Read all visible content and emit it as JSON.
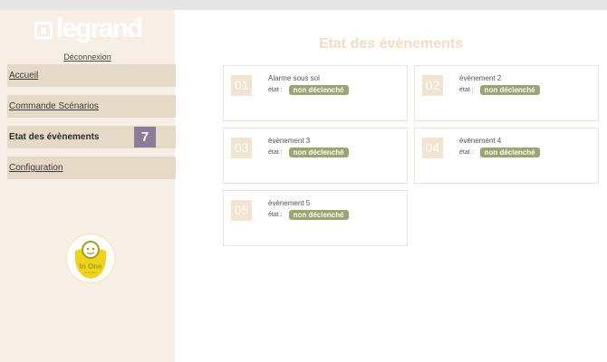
{
  "sidebar": {
    "brand": "legrand",
    "brand_mark": "®",
    "logout_label": "Déconnexion",
    "items": [
      {
        "label": "Accueil"
      },
      {
        "label": "Commande Scénarios"
      },
      {
        "label": "Etat des évènements",
        "badge": "7"
      },
      {
        "label": "Configuration"
      }
    ],
    "product_logo": {
      "line1": "In One",
      "line2": "by legrand"
    }
  },
  "main": {
    "title": "Etat des évènements",
    "state_label": "état :",
    "events": [
      {
        "num": "01",
        "name": "Alarme sous sol",
        "state": "non déclenché"
      },
      {
        "num": "02",
        "name": "évènement 2",
        "state": "non déclenché"
      },
      {
        "num": "03",
        "name": "évènement 3",
        "state": "non déclenché"
      },
      {
        "num": "04",
        "name": "évènement 4",
        "state": "non déclenché"
      },
      {
        "num": "05",
        "name": "évènement 5",
        "state": "non déclenché"
      }
    ]
  },
  "colors": {
    "sidebar_bg": "#f7efe6",
    "nav_bg": "#e7d9c7",
    "badge_bg": "#8d7b97",
    "pill_bg": "#9ba572",
    "title": "#f3dcc4"
  }
}
